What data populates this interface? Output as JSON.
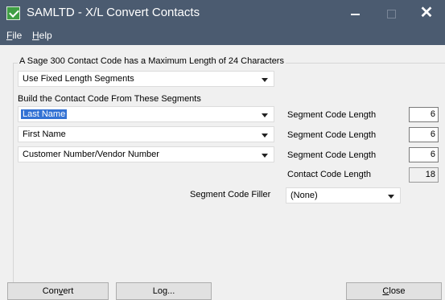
{
  "window": {
    "title": "SAMLTD - X/L Convert Contacts",
    "close_glyph": "✕"
  },
  "menu": {
    "file": {
      "underlined": "F",
      "rest": "ile"
    },
    "help": {
      "underlined": "H",
      "rest": "elp"
    }
  },
  "group": {
    "title": "A Sage 300 Contact Code has a Maximum Length of 24 Characters"
  },
  "segment_mode": {
    "value": "Use Fixed Length Segments"
  },
  "build_label": "Build the Contact Code From These Segments",
  "segments": [
    {
      "value": "Last Name",
      "length_label": "Segment Code Length",
      "length": "6"
    },
    {
      "value": "First Name",
      "length_label": "Segment Code Length",
      "length": "6"
    },
    {
      "value": "Customer Number/Vendor Number",
      "length_label": "Segment Code Length",
      "length": "6"
    }
  ],
  "contact_code_length": {
    "label": "Contact Code Length",
    "value": "18"
  },
  "filler": {
    "label": "Segment Code Filler",
    "value": "(None)"
  },
  "buttons": {
    "convert": {
      "before": "Con",
      "underlined": "v",
      "after": "ert"
    },
    "log": {
      "label": "Log..."
    },
    "close": {
      "underlined": "C",
      "rest": "lose"
    }
  }
}
